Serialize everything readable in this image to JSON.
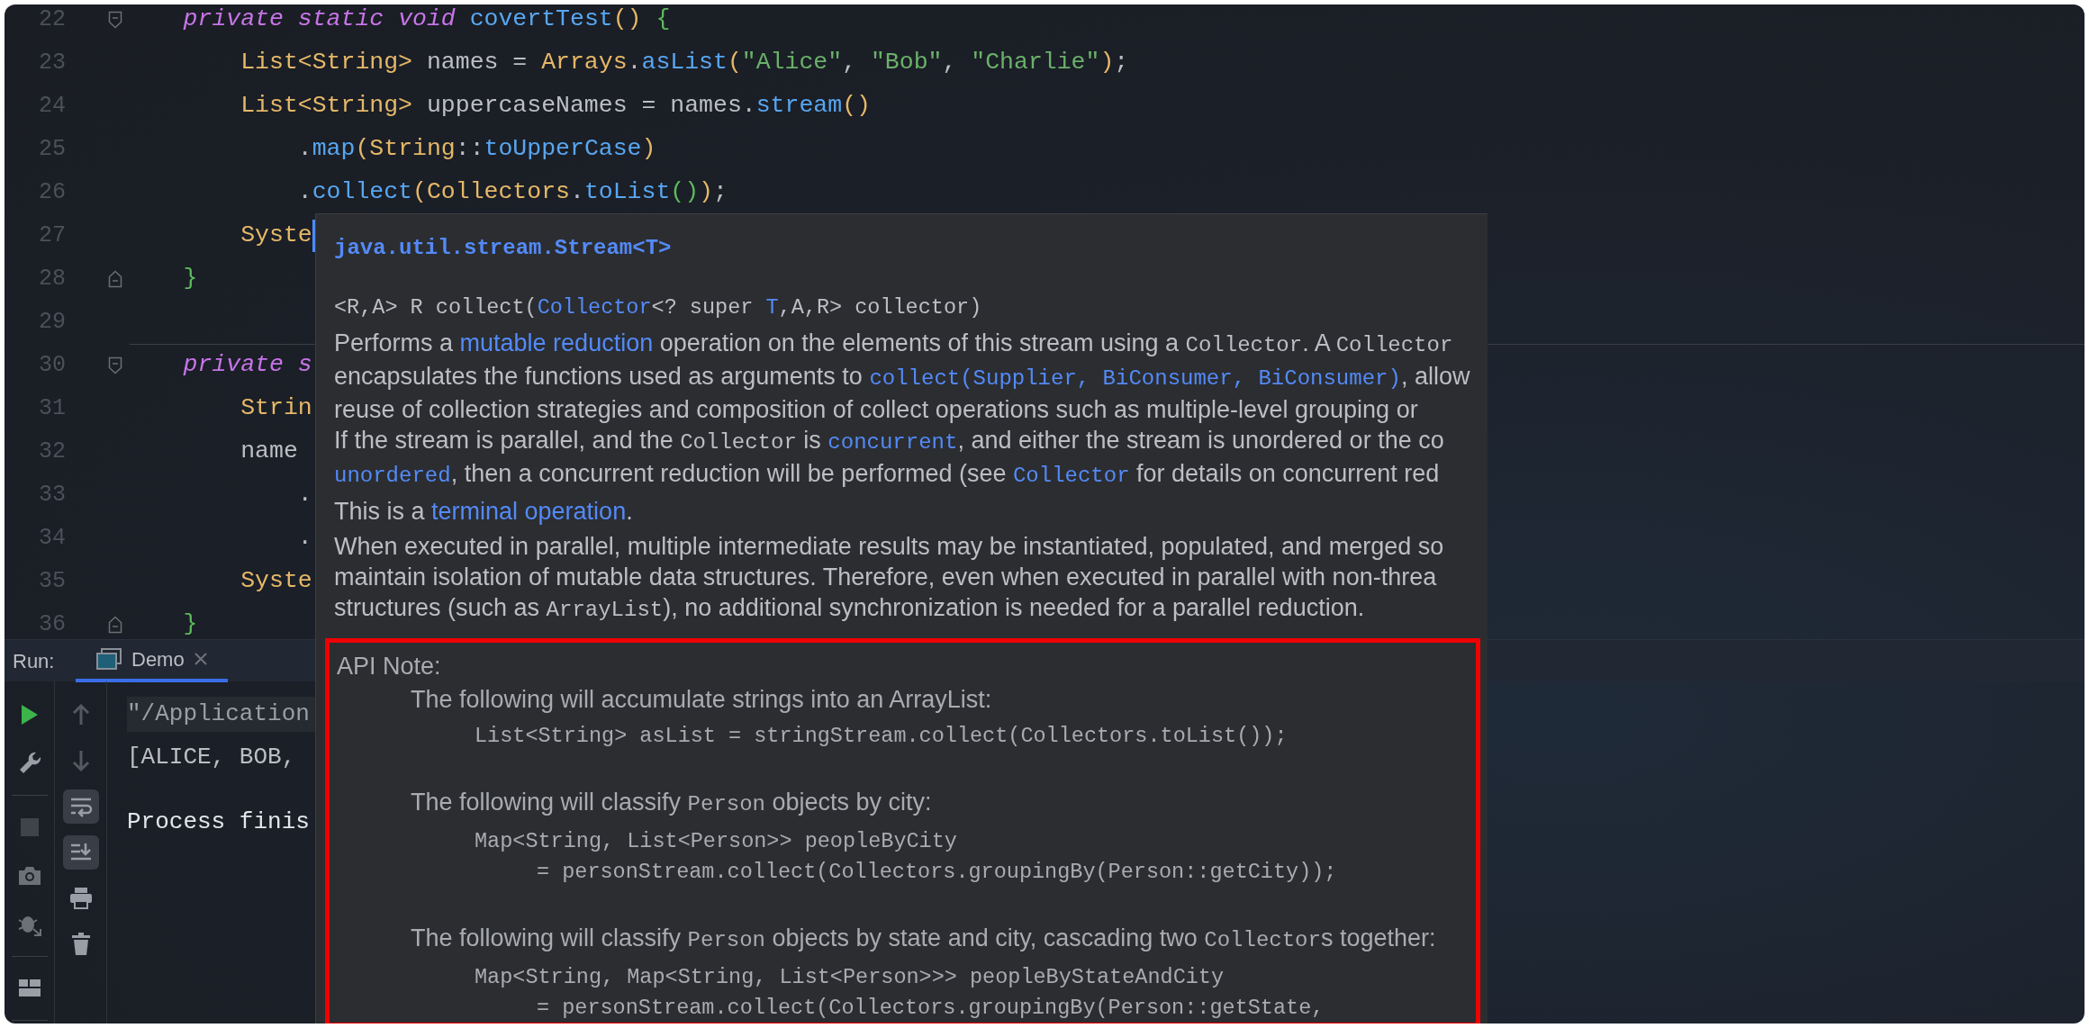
{
  "editor": {
    "lines": [
      {
        "number": "22",
        "fold_start": true,
        "kind": "member",
        "tokens": [
          {
            "kind": "keyword",
            "text": "private static void "
          },
          {
            "kind": "method",
            "text": "covertTest"
          },
          {
            "kind": "paren1",
            "text": "()"
          },
          {
            "kind": "paren2",
            "text": " {"
          }
        ]
      },
      {
        "number": "23",
        "kind": "statement",
        "tokens": [
          {
            "kind": "class",
            "text": "List<String>"
          },
          {
            "kind": "text",
            "text": " names = "
          },
          {
            "kind": "class",
            "text": "Arrays"
          },
          {
            "kind": "text",
            "text": "."
          },
          {
            "kind": "method",
            "text": "asList"
          },
          {
            "kind": "paren1",
            "text": "("
          },
          {
            "kind": "string",
            "text": "\"Alice\""
          },
          {
            "kind": "text",
            "text": ", "
          },
          {
            "kind": "string",
            "text": "\"Bob\""
          },
          {
            "kind": "text",
            "text": ", "
          },
          {
            "kind": "string",
            "text": "\"Charlie\""
          },
          {
            "kind": "paren1",
            "text": ")"
          },
          {
            "kind": "text",
            "text": ";"
          }
        ]
      },
      {
        "number": "24",
        "kind": "statement",
        "tokens": [
          {
            "kind": "class",
            "text": "List<String>"
          },
          {
            "kind": "text",
            "text": " uppercaseNames = names."
          },
          {
            "kind": "method",
            "text": "stream"
          },
          {
            "kind": "paren1",
            "text": "()"
          }
        ]
      },
      {
        "number": "25",
        "kind": "chain",
        "tokens": [
          {
            "kind": "text",
            "text": "."
          },
          {
            "kind": "method",
            "text": "map"
          },
          {
            "kind": "paren1",
            "text": "("
          },
          {
            "kind": "class",
            "text": "String"
          },
          {
            "kind": "text",
            "text": "::"
          },
          {
            "kind": "method",
            "text": "toUpperCase"
          },
          {
            "kind": "paren1",
            "text": ")"
          }
        ]
      },
      {
        "number": "26",
        "kind": "chain",
        "tokens": [
          {
            "kind": "text",
            "text": "."
          },
          {
            "kind": "method",
            "text": "collect"
          },
          {
            "kind": "paren1",
            "text": "("
          },
          {
            "kind": "class",
            "text": "Collectors"
          },
          {
            "kind": "text",
            "text": "."
          },
          {
            "kind": "method",
            "text": "toList"
          },
          {
            "kind": "paren2",
            "text": "()"
          },
          {
            "kind": "paren1",
            "text": ")"
          },
          {
            "kind": "text",
            "text": ";"
          }
        ]
      },
      {
        "number": "27",
        "kind": "statement",
        "caret": true,
        "tokens": [
          {
            "kind": "class",
            "text": "Syste"
          }
        ]
      },
      {
        "number": "28",
        "fold_end": true,
        "kind": "member",
        "tokens": [
          {
            "kind": "paren2",
            "text": "}"
          }
        ]
      },
      {
        "number": "29"
      },
      {
        "number": "30",
        "fold_start": true,
        "separator": true,
        "kind": "member",
        "tokens": [
          {
            "kind": "keyword",
            "text": "private s"
          }
        ]
      },
      {
        "number": "31",
        "kind": "statement",
        "tokens": [
          {
            "kind": "class",
            "text": "Strin"
          }
        ]
      },
      {
        "number": "32",
        "kind": "statement",
        "tokens": [
          {
            "kind": "text",
            "text": "name"
          }
        ]
      },
      {
        "number": "33",
        "kind": "chain",
        "tokens": [
          {
            "kind": "text",
            "text": "."
          }
        ]
      },
      {
        "number": "34",
        "kind": "chain",
        "tokens": [
          {
            "kind": "text",
            "text": "."
          }
        ]
      },
      {
        "number": "35",
        "kind": "statement",
        "tokens": [
          {
            "kind": "class",
            "text": "Syste"
          }
        ]
      },
      {
        "number": "36",
        "fold_end": true,
        "kind": "member",
        "tokens": [
          {
            "kind": "paren2",
            "text": "}"
          }
        ]
      }
    ]
  },
  "doc_popup": {
    "header": "java.util.stream.Stream<T>",
    "signature": [
      {
        "kind": "text",
        "text": "<R,A> R collect("
      },
      {
        "kind": "link",
        "text": "Collector"
      },
      {
        "kind": "text",
        "text": "<? super "
      },
      {
        "kind": "link",
        "text": "T"
      },
      {
        "kind": "text",
        "text": ",A,R> collector)"
      }
    ],
    "paragraphs": [
      {
        "lines": [
          [
            {
              "kind": "text",
              "text": "Performs a "
            },
            {
              "kind": "link",
              "text": "mutable reduction"
            },
            {
              "kind": "text",
              "text": " operation on the elements of this stream using a "
            },
            {
              "kind": "code",
              "text": "Collector"
            },
            {
              "kind": "text",
              "text": ". A "
            },
            {
              "kind": "code",
              "text": "Collector"
            }
          ],
          [
            {
              "kind": "text",
              "text": "encapsulates the functions used as arguments to "
            },
            {
              "kind": "link-code",
              "text": "collect(Supplier, BiConsumer, BiConsumer)"
            },
            {
              "kind": "text",
              "text": ", allow"
            }
          ],
          [
            {
              "kind": "text",
              "text": "reuse of collection strategies and composition of collect operations such as multiple-level grouping or"
            }
          ],
          [
            {
              "kind": "text",
              "text": "If the stream is parallel, and the "
            },
            {
              "kind": "code",
              "text": "Collector"
            },
            {
              "kind": "text",
              "text": " is "
            },
            {
              "kind": "link-code",
              "text": "concurrent"
            },
            {
              "kind": "text",
              "text": ", and either the stream is unordered or the co"
            }
          ],
          [
            {
              "kind": "link-code",
              "text": "unordered"
            },
            {
              "kind": "text",
              "text": ", then a concurrent reduction will be performed (see "
            },
            {
              "kind": "link-code",
              "text": "Collector"
            },
            {
              "kind": "text",
              "text": " for details on concurrent red"
            }
          ]
        ]
      },
      {
        "lines": [
          [
            {
              "kind": "text",
              "text": "This is a "
            },
            {
              "kind": "link",
              "text": "terminal operation"
            },
            {
              "kind": "text",
              "text": "."
            }
          ]
        ]
      },
      {
        "lines": [
          [
            {
              "kind": "text",
              "text": "When executed in parallel, multiple intermediate results may be instantiated, populated, and merged so"
            }
          ],
          [
            {
              "kind": "text",
              "text": "maintain isolation of mutable data structures. Therefore, even when executed in parallel with non-threa"
            }
          ],
          [
            {
              "kind": "text",
              "text": "structures (such as "
            },
            {
              "kind": "code",
              "text": "ArrayList"
            },
            {
              "kind": "text",
              "text": "), no additional synchronization is needed for a parallel reduction."
            }
          ]
        ]
      }
    ],
    "api_note": {
      "highlighted": true,
      "label": "API Note:",
      "items": [
        {
          "kind": "prose",
          "segments": [
            {
              "kind": "text",
              "text": "The following will accumulate strings into an ArrayList:"
            }
          ]
        },
        {
          "kind": "code",
          "lines": [
            {
              "text": "List<String> asList = stringStream.collect(Collectors.toList());",
              "continued": false
            }
          ]
        },
        {
          "kind": "prose",
          "segments": [
            {
              "kind": "text",
              "text": "The following will classify "
            },
            {
              "kind": "code",
              "text": "Person"
            },
            {
              "kind": "text",
              "text": " objects by city:"
            }
          ]
        },
        {
          "kind": "code",
          "lines": [
            {
              "text": "Map<String, List<Person>> peopleByCity",
              "continued": false
            },
            {
              "text": "= personStream.collect(Collectors.groupingBy(Person::getCity));",
              "continued": true
            }
          ]
        },
        {
          "kind": "prose",
          "segments": [
            {
              "kind": "text",
              "text": "The following will classify "
            },
            {
              "kind": "code",
              "text": "Person"
            },
            {
              "kind": "text",
              "text": " objects by state and city, cascading two "
            },
            {
              "kind": "code",
              "text": "Collector"
            },
            {
              "kind": "text",
              "text": "s together:"
            }
          ]
        },
        {
          "kind": "code",
          "lines": [
            {
              "text": "Map<String, Map<String, List<Person>>> peopleByStateAndCity",
              "continued": false
            },
            {
              "text": "= personStream.collect(Collectors.groupingBy(Person::getState,",
              "continued": true
            }
          ]
        }
      ]
    }
  },
  "run_panel": {
    "label": "Run:",
    "tabs": [
      {
        "label": "Demo",
        "selected": true
      }
    ],
    "left_tools": [
      {
        "disabled": false
      },
      {
        "disabled": false
      },
      {
        "disabled": true
      },
      {
        "disabled": false
      },
      {
        "disabled": false
      },
      {
        "disabled": false
      }
    ],
    "right_tools": [
      {
        "disabled": true,
        "selected": false
      },
      {
        "disabled": true,
        "selected": false
      },
      {
        "disabled": false,
        "selected": true
      },
      {
        "disabled": false,
        "selected": true
      },
      {
        "disabled": false,
        "selected": false
      },
      {
        "disabled": false,
        "selected": false
      }
    ],
    "console": [
      {
        "kind": "command",
        "text": "\"/Application"
      },
      {
        "kind": "output",
        "text": "[ALICE, BOB,"
      },
      {
        "kind": "status",
        "text": "Process finis"
      }
    ]
  }
}
